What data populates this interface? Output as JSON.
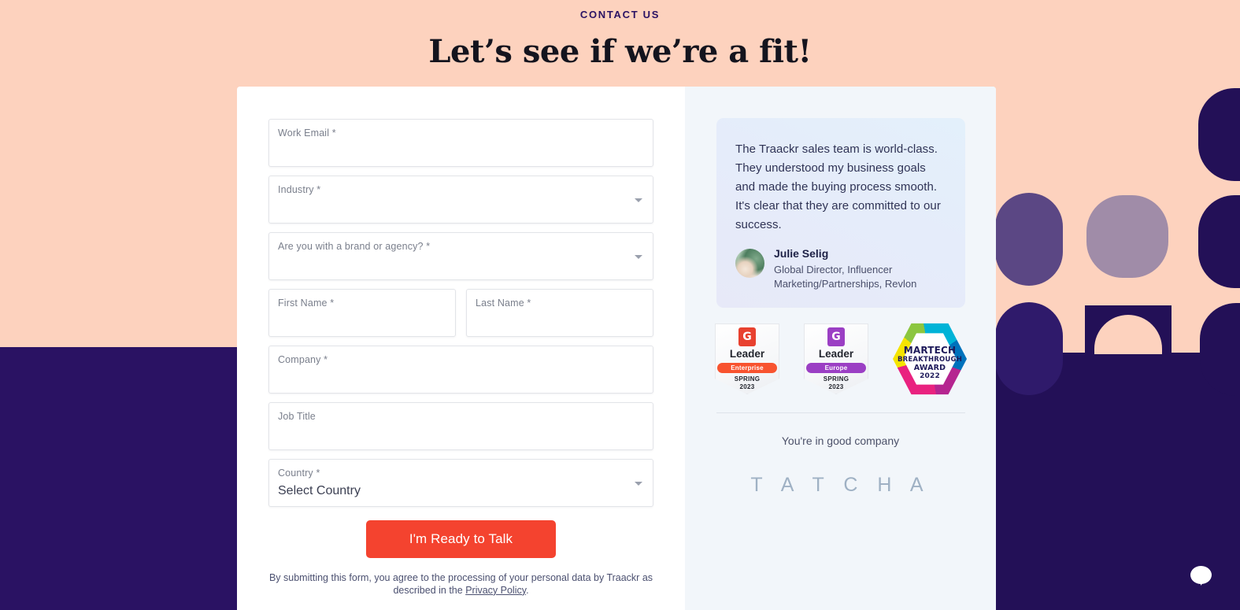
{
  "header": {
    "eyebrow": "CONTACT US",
    "headline": "Let’s see if we’re a fit!"
  },
  "form": {
    "fields": [
      {
        "name": "work-email",
        "label": "Work Email *",
        "value": "",
        "type": "text"
      },
      {
        "name": "industry",
        "label": "Industry *",
        "value": "",
        "type": "select"
      },
      {
        "name": "brand-agency",
        "label": "Are you with a brand or agency? *",
        "value": "",
        "type": "select"
      },
      {
        "name": "first-name",
        "label": "First Name *",
        "value": "",
        "type": "text"
      },
      {
        "name": "last-name",
        "label": "Last Name *",
        "value": "",
        "type": "text"
      },
      {
        "name": "company",
        "label": "Company *",
        "value": "",
        "type": "text"
      },
      {
        "name": "job-title",
        "label": "Job Title",
        "value": "",
        "type": "text"
      },
      {
        "name": "country",
        "label": "Country *",
        "value": "Select Country",
        "type": "select"
      }
    ],
    "submit_label": "I'm Ready to Talk",
    "disclaimer_prefix": "By submitting this form, you agree to the processing of your personal data by Traackr as described in the ",
    "privacy_link_label": "Privacy Policy",
    "disclaimer_suffix": "."
  },
  "sidebar": {
    "testimonial": {
      "quote": "The Traackr sales team is world-class. They understood my business goals and made the buying process smooth. It's clear that they are committed to our success.",
      "author_name": "Julie Selig",
      "author_role": "Global Director, Influencer Marketing/Partnerships, Revlon"
    },
    "badges": [
      {
        "id": "g2-leader-enterprise",
        "logo": "G",
        "logo_color": "#e8412f",
        "title": "Leader",
        "ribbon": "Enterprise",
        "ribbon_color": "#f8532f",
        "season": "SPRING",
        "year": "2023"
      },
      {
        "id": "g2-leader-europe",
        "logo": "G",
        "logo_color": "#9b3fc4",
        "title": "Leader",
        "ribbon": "Europe",
        "ribbon_color": "#9b3fc4",
        "season": "SPRING",
        "year": "2023"
      },
      {
        "id": "martech-breakthrough-award",
        "line1": "MARTECH",
        "line2": "BREAKTHROUGH",
        "line3": "AWARD",
        "line4": "2022"
      }
    ],
    "good_company_label": "You're in good company",
    "client_logo": "T A T C H A"
  },
  "chat": {
    "icon": "chat-bubble-icon"
  },
  "colors": {
    "peach_background": "#fdd2be",
    "navy": "#2a1263",
    "accent_red": "#f4432f",
    "sidebar_background": "#f2f6fa",
    "deco_light_purple": "#a08ca8",
    "deco_mid_purple": "#5b4784"
  }
}
